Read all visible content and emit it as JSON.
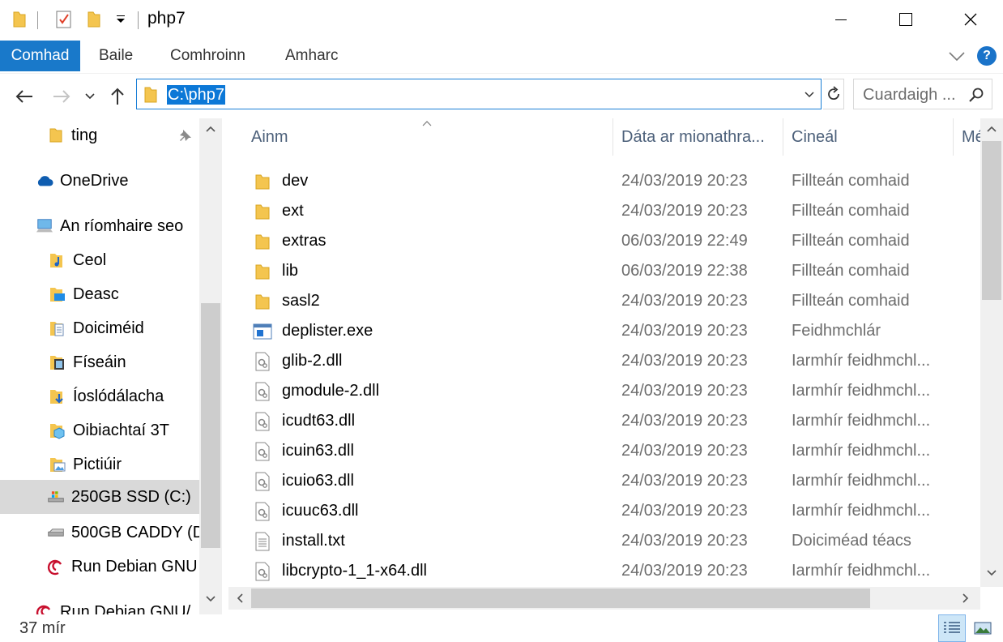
{
  "window": {
    "title": "php7"
  },
  "ribbon": {
    "tabs": [
      "Comhad",
      "Baile",
      "Comhroinn",
      "Amharc"
    ],
    "help_label": "?"
  },
  "address": {
    "path": "C:\\php7",
    "search_placeholder": "Cuardaigh ..."
  },
  "nav": {
    "items": [
      {
        "label": "ting",
        "icon": "folder-icon"
      },
      {
        "label": "OneDrive",
        "icon": "cloud-icon"
      },
      {
        "label": "An ríomhaire seo",
        "icon": "computer-icon"
      },
      {
        "label": "Ceol",
        "icon": "music-folder-icon"
      },
      {
        "label": "Deasc",
        "icon": "desktop-folder-icon"
      },
      {
        "label": "Doiciméid",
        "icon": "documents-folder-icon"
      },
      {
        "label": "Físeáin",
        "icon": "videos-folder-icon"
      },
      {
        "label": "Íoslódálacha",
        "icon": "downloads-folder-icon"
      },
      {
        "label": "Oibiachtaí 3T",
        "icon": "3d-objects-folder-icon"
      },
      {
        "label": "Pictiúir",
        "icon": "pictures-folder-icon"
      },
      {
        "label": "250GB SSD (C:)",
        "icon": "drive-icon"
      },
      {
        "label": "500GB CADDY (D",
        "icon": "drive-icon"
      },
      {
        "label": "Run Debian GNU",
        "icon": "debian-icon"
      },
      {
        "label": "Run Debian GNU/",
        "icon": "debian-icon"
      }
    ]
  },
  "columns": {
    "name": "Ainm",
    "date": "Dáta ar mionathra...",
    "type": "Cineál",
    "size": "Mé"
  },
  "files": [
    {
      "name": "dev",
      "date": "24/03/2019 20:23",
      "type": "Fillteán comhaid",
      "icon": "folder-icon"
    },
    {
      "name": "ext",
      "date": "24/03/2019 20:23",
      "type": "Fillteán comhaid",
      "icon": "folder-icon"
    },
    {
      "name": "extras",
      "date": "06/03/2019 22:49",
      "type": "Fillteán comhaid",
      "icon": "folder-icon"
    },
    {
      "name": "lib",
      "date": "06/03/2019 22:38",
      "type": "Fillteán comhaid",
      "icon": "folder-icon"
    },
    {
      "name": "sasl2",
      "date": "24/03/2019 20:23",
      "type": "Fillteán comhaid",
      "icon": "folder-icon"
    },
    {
      "name": "deplister.exe",
      "date": "24/03/2019 20:23",
      "type": "Feidhmchlár",
      "icon": "exe-icon"
    },
    {
      "name": "glib-2.dll",
      "date": "24/03/2019 20:23",
      "type": "Iarmhír feidhmchl...",
      "icon": "dll-icon"
    },
    {
      "name": "gmodule-2.dll",
      "date": "24/03/2019 20:23",
      "type": "Iarmhír feidhmchl...",
      "icon": "dll-icon"
    },
    {
      "name": "icudt63.dll",
      "date": "24/03/2019 20:23",
      "type": "Iarmhír feidhmchl...",
      "icon": "dll-icon"
    },
    {
      "name": "icuin63.dll",
      "date": "24/03/2019 20:23",
      "type": "Iarmhír feidhmchl...",
      "icon": "dll-icon"
    },
    {
      "name": "icuio63.dll",
      "date": "24/03/2019 20:23",
      "type": "Iarmhír feidhmchl...",
      "icon": "dll-icon"
    },
    {
      "name": "icuuc63.dll",
      "date": "24/03/2019 20:23",
      "type": "Iarmhír feidhmchl...",
      "icon": "dll-icon"
    },
    {
      "name": "install.txt",
      "date": "24/03/2019 20:23",
      "type": "Doiciméad téacs",
      "icon": "text-file-icon"
    },
    {
      "name": "libcrypto-1_1-x64.dll",
      "date": "24/03/2019 20:23",
      "type": "Iarmhír feidhmchl...",
      "icon": "dll-icon"
    }
  ],
  "status": {
    "count": "37 mír"
  },
  "colors": {
    "accent": "#1979ca",
    "selection": "#0c78d7",
    "folder": "#f4c54f"
  }
}
